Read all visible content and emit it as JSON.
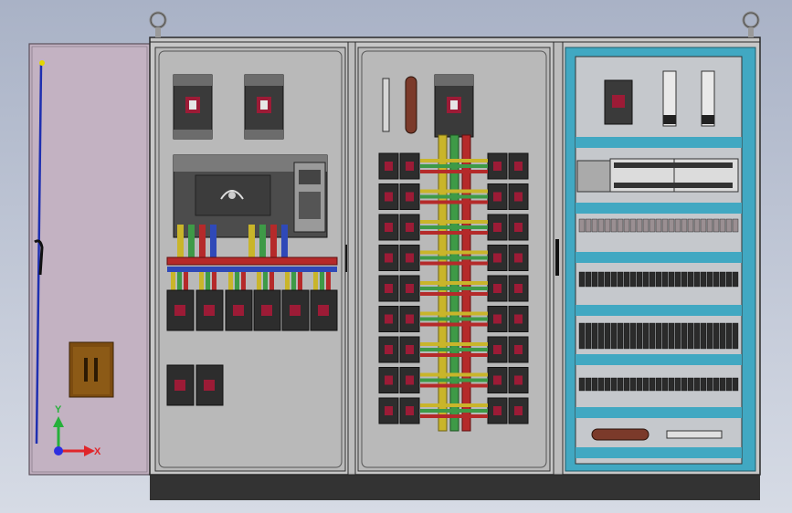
{
  "scene": {
    "subject": "electrical-control-cabinet-3d-model",
    "sections": [
      "left-power-panel",
      "middle-distribution-panel",
      "right-plc-panel"
    ],
    "colors": {
      "background": "#b8c0d1",
      "cabinet_frame": "#c7c7c7",
      "mounting_plate": "#b9b9b9",
      "door": "#c3b2c2",
      "base": "#333333",
      "busbar_yellow": "#c9b52a",
      "busbar_green": "#3e9a47",
      "busbar_red": "#b52a2a",
      "busbar_blue": "#2f49b8",
      "din_rail_teal": "#41a8c2",
      "breaker_dark": "#2d2d2d",
      "breaker_indicator": "#9c1b36"
    }
  },
  "axes_triad": {
    "x_label": "X",
    "y_label": "Y",
    "x_color": "#e0262b",
    "y_color": "#26b03a",
    "z_color": "#2e2fe0"
  },
  "counts": {
    "middle_breaker_rows": 9,
    "left_bottom_breakers": 6,
    "lifting_eyes": 2
  }
}
